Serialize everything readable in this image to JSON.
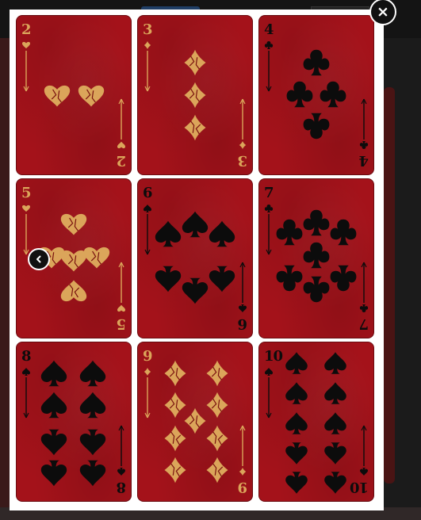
{
  "lightbox": {
    "close_label": "×",
    "prev_icon": "chevron-left-icon",
    "close_icon": "close-icon"
  },
  "colors": {
    "card_red": "#a4121a",
    "gold": "#dba55a",
    "black": "#0c0c0c"
  },
  "cards": [
    {
      "rank": "2",
      "suit": "heart"
    },
    {
      "rank": "3",
      "suit": "diamond"
    },
    {
      "rank": "4",
      "suit": "club"
    },
    {
      "rank": "5",
      "suit": "heart"
    },
    {
      "rank": "6",
      "suit": "spade"
    },
    {
      "rank": "7",
      "suit": "club"
    },
    {
      "rank": "8",
      "suit": "spade"
    },
    {
      "rank": "9",
      "suit": "diamond"
    },
    {
      "rank": "10",
      "suit": "spade"
    }
  ]
}
